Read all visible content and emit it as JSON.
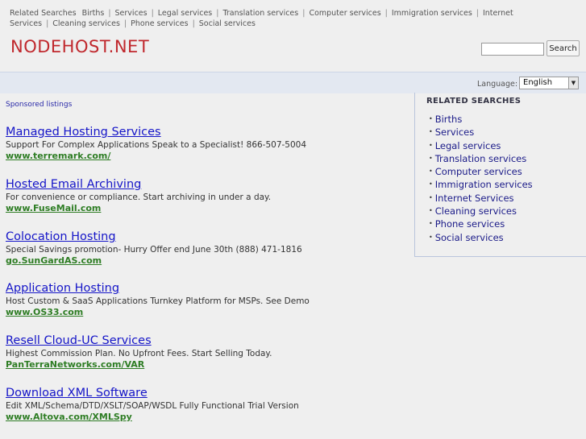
{
  "topnav": {
    "lead": "Related Searches",
    "links": [
      "Births",
      "Services",
      "Legal services",
      "Translation services",
      "Computer services",
      "Immigration services",
      "Internet Services",
      "Cleaning services",
      "Phone services",
      "Social services"
    ]
  },
  "header": {
    "logo": "NODEHOST.NET",
    "search_placeholder": "",
    "search_button": "Search"
  },
  "language": {
    "label": "Language:",
    "selected": "English"
  },
  "main": {
    "sponsored_label": "Sponsored listings",
    "listings": [
      {
        "title": "Managed Hosting Services",
        "desc": "Support For Complex Applications Speak to a Specialist! 866-507-5004",
        "url": "www.terremark.com/"
      },
      {
        "title": "Hosted Email Archiving",
        "desc": "For convenience or compliance. Start archiving in under a day.",
        "url": "www.FuseMail.com"
      },
      {
        "title": "Colocation Hosting",
        "desc": "Special Savings promotion- Hurry Offer end June 30th (888) 471-1816",
        "url": "go.SunGardAS.com"
      },
      {
        "title": "Application Hosting",
        "desc": "Host Custom & SaaS Applications Turnkey Platform for MSPs. See Demo",
        "url": "www.OS33.com"
      },
      {
        "title": "Resell Cloud-UC Services",
        "desc": "Highest Commission Plan. No Upfront Fees. Start Selling Today.",
        "url": "PanTerraNetworks.com/VAR"
      },
      {
        "title": "Download XML Software",
        "desc": "Edit XML/Schema/DTD/XSLT/SOAP/WSDL Fully Functional Trial Version",
        "url": "www.Altova.com/XMLSpy"
      }
    ]
  },
  "related": {
    "heading": "RELATED SEARCHES",
    "items": [
      "Births",
      "Services",
      "Legal services",
      "Translation services",
      "Computer services",
      "Immigration services",
      "Internet Services",
      "Cleaning services",
      "Phone services",
      "Social services"
    ]
  },
  "colors": {
    "logo": "#c0282d",
    "link": "#1515c8",
    "url": "#2e7d24",
    "langbar": "#e3e8f1",
    "background": "#efefef"
  }
}
